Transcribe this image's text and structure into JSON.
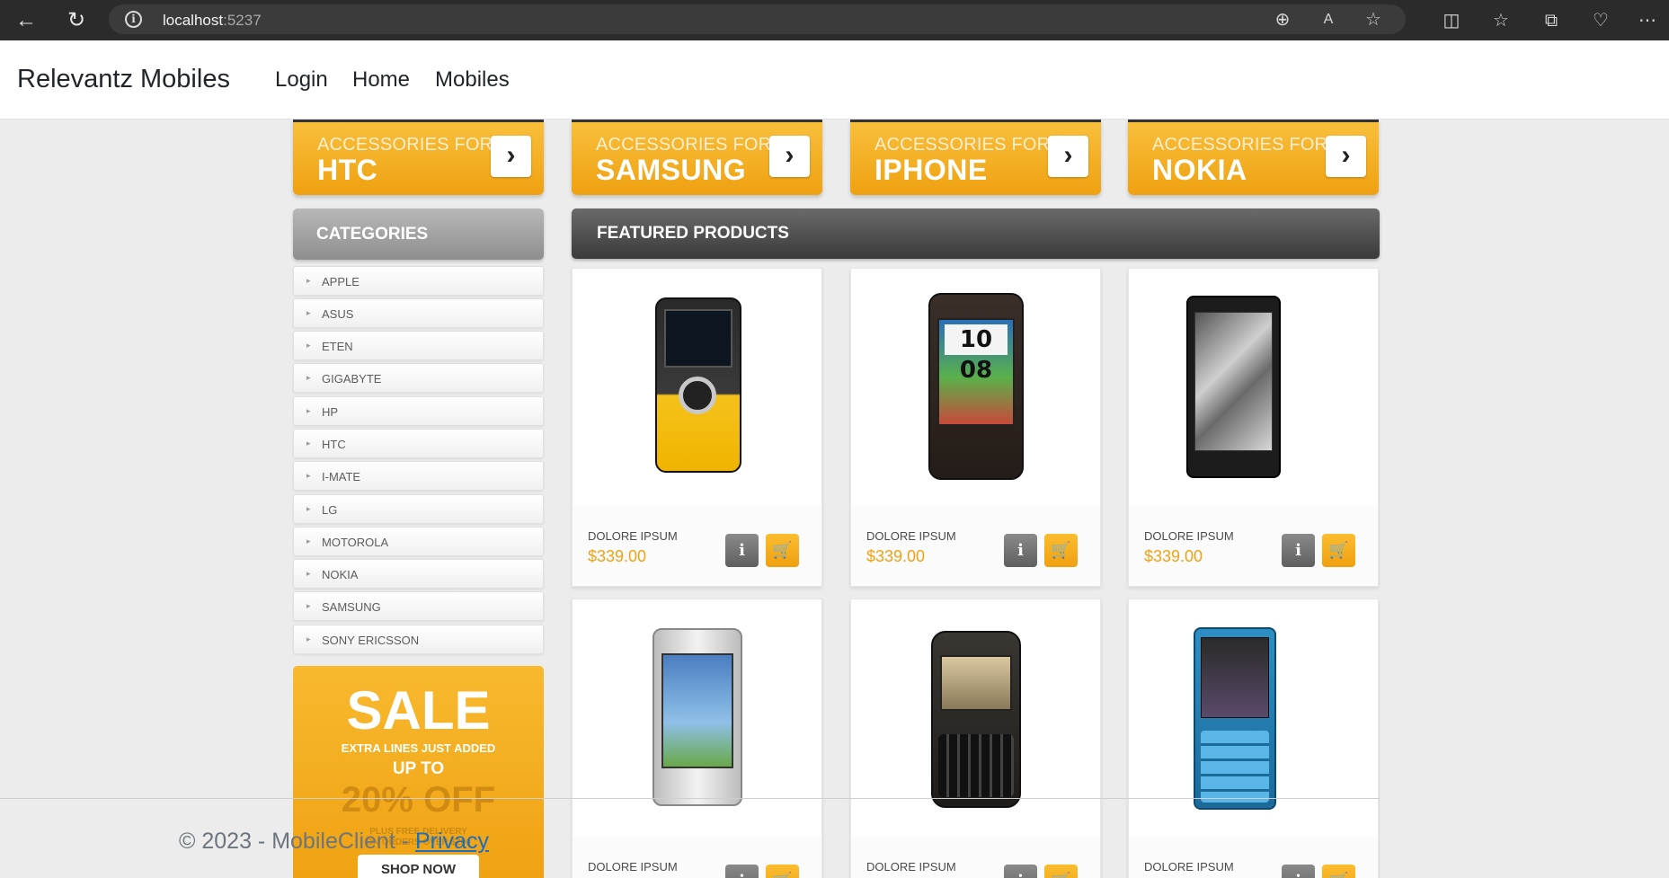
{
  "browser": {
    "url_host": "localhost",
    "url_port": ":5237"
  },
  "navbar": {
    "brand": "Relevantz Mobiles",
    "links": [
      "Login",
      "Home",
      "Mobiles"
    ]
  },
  "accessories": {
    "prefix": "ACCESSORIES FOR",
    "brands": [
      "HTC",
      "SAMSUNG",
      "IPHONE",
      "NOKIA"
    ]
  },
  "categories": {
    "title": "CATEGORIES",
    "items": [
      "APPLE",
      "ASUS",
      "ETEN",
      "GIGABYTE",
      "HP",
      "HTC",
      "I-MATE",
      "LG",
      "MOTOROLA",
      "NOKIA",
      "SAMSUNG",
      "SONY ERICSSON"
    ]
  },
  "sale": {
    "title": "SALE",
    "line1": "EXTRA LINES JUST ADDED",
    "line2": "UP TO",
    "discount": "20% OFF",
    "line3": "PLUS FREE DELIVERY",
    "line4": "ON ORDERS OVER $200",
    "cta": "SHOP NOW"
  },
  "featured": {
    "title": "FEATURED PRODUCTS",
    "products": [
      {
        "name": "DOLORE IPSUM",
        "price": "$339.00"
      },
      {
        "name": "DOLORE IPSUM",
        "price": "$339.00"
      },
      {
        "name": "DOLORE IPSUM",
        "price": "$339.00"
      },
      {
        "name": "DOLORE IPSUM",
        "price": ""
      },
      {
        "name": "DOLORE IPSUM",
        "price": ""
      },
      {
        "name": "DOLORE IPSUM",
        "price": ""
      }
    ]
  },
  "footer": {
    "copyright": "© 2023 - MobileClient - ",
    "privacy_link": "Privacy"
  },
  "colors": {
    "accent": "#f0a215",
    "dark_header": "#4a4a4a"
  }
}
